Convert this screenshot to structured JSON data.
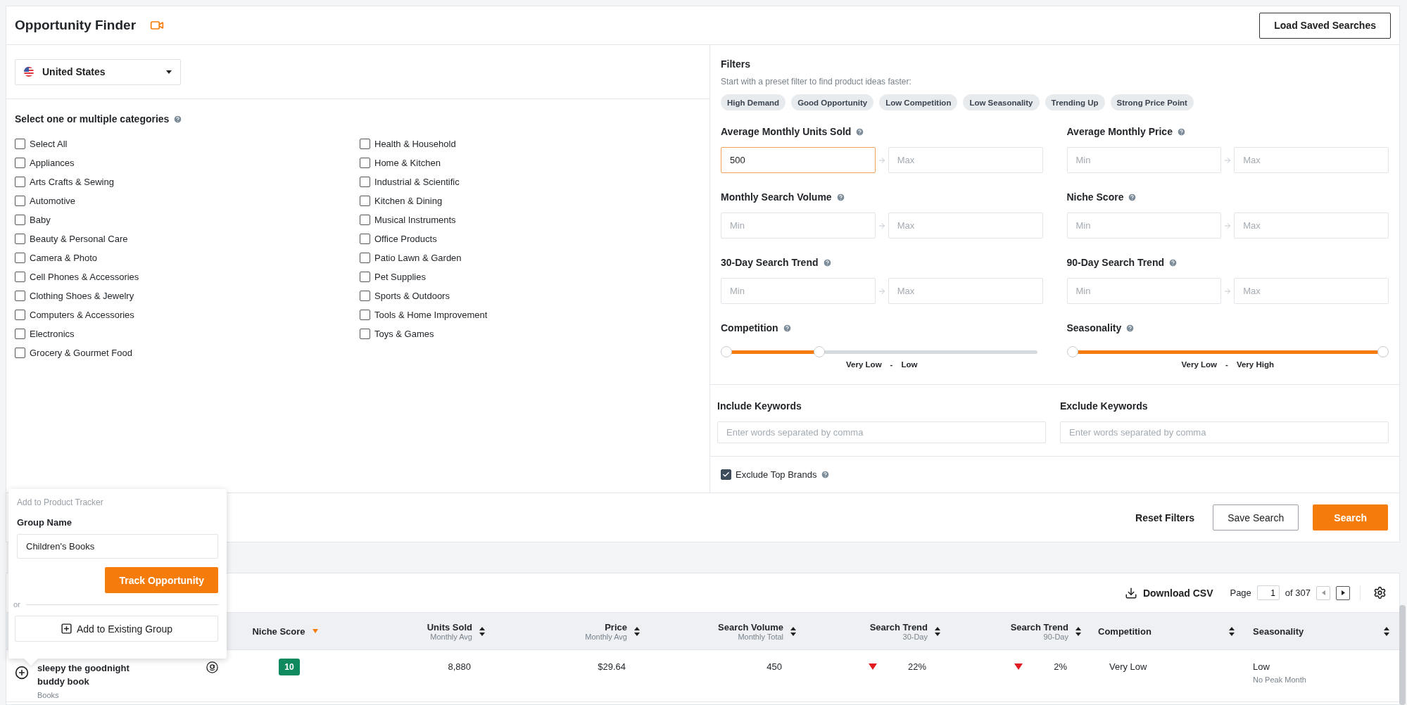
{
  "header": {
    "title": "Opportunity Finder",
    "load_button": "Load Saved Searches"
  },
  "country": {
    "value": "United States"
  },
  "categories": {
    "title": "Select one or multiple categories",
    "columns": [
      [
        {
          "label": "Select All",
          "checked": false
        },
        {
          "label": "Appliances",
          "checked": false
        },
        {
          "label": "Arts Crafts & Sewing",
          "checked": false
        },
        {
          "label": "Automotive",
          "checked": false
        },
        {
          "label": "Baby",
          "checked": false
        },
        {
          "label": "Beauty & Personal Care",
          "checked": false
        },
        {
          "label": "Camera & Photo",
          "checked": false
        },
        {
          "label": "Cell Phones & Accessories",
          "checked": false
        },
        {
          "label": "Clothing Shoes & Jewelry",
          "checked": false
        },
        {
          "label": "Computers & Accessories",
          "checked": false
        },
        {
          "label": "Electronics",
          "checked": false
        },
        {
          "label": "Grocery & Gourmet Food",
          "checked": false
        }
      ],
      [
        {
          "label": "Health & Household",
          "checked": false
        },
        {
          "label": "Home & Kitchen",
          "checked": false
        },
        {
          "label": "Industrial & Scientific",
          "checked": false
        },
        {
          "label": "Kitchen & Dining",
          "checked": false
        },
        {
          "label": "Musical Instruments",
          "checked": false
        },
        {
          "label": "Office Products",
          "checked": false
        },
        {
          "label": "Patio Lawn & Garden",
          "checked": false
        },
        {
          "label": "Pet Supplies",
          "checked": false
        },
        {
          "label": "Sports & Outdoors",
          "checked": false
        },
        {
          "label": "Tools & Home Improvement",
          "checked": false
        },
        {
          "label": "Toys & Games",
          "checked": false
        }
      ]
    ]
  },
  "filters": {
    "title": "Filters",
    "subtitle": "Start with a preset filter to find product ideas faster:",
    "presets": [
      "High Demand",
      "Good Opportunity",
      "Low Competition",
      "Low Seasonality",
      "Trending Up",
      "Strong Price Point"
    ],
    "ranges": [
      {
        "label": "Average Monthly Units Sold",
        "min": {
          "value": "500",
          "focused": true
        },
        "max": {
          "placeholder": "Max",
          "focused": false
        }
      },
      {
        "label": "Average Monthly Price",
        "min": {
          "placeholder": "Min",
          "focused": false
        },
        "max": {
          "placeholder": "Max",
          "focused": false
        }
      },
      {
        "label": "Monthly Search Volume",
        "min": {
          "placeholder": "Min",
          "focused": false
        },
        "max": {
          "placeholder": "Max",
          "focused": false
        }
      },
      {
        "label": "Niche Score",
        "min": {
          "placeholder": "Min",
          "focused": false
        },
        "max": {
          "placeholder": "Max",
          "focused": false
        }
      },
      {
        "label": "30-Day Search Trend",
        "min": {
          "placeholder": "Min",
          "focused": false
        },
        "max": {
          "placeholder": "Max",
          "focused": false
        }
      },
      {
        "label": "90-Day Search Trend",
        "min": {
          "placeholder": "Min",
          "focused": false
        },
        "max": {
          "placeholder": "Max",
          "focused": false
        }
      }
    ],
    "sliders": [
      {
        "label": "Competition",
        "thumbs": [
          {
            "level": 0
          },
          {
            "level": 0.3
          }
        ],
        "from": "Very Low",
        "separator": "-",
        "to": "Low"
      },
      {
        "label": "Seasonality",
        "thumbs": [
          {
            "level": 0
          },
          {
            "level": 1
          }
        ],
        "from": "Very Low",
        "separator": "-",
        "to": "Very High"
      }
    ],
    "keywords": [
      {
        "label": "Include Keywords",
        "placeholder": "Enter words separated by comma"
      },
      {
        "label": "Exclude Keywords",
        "placeholder": "Enter words separated by comma"
      }
    ],
    "exclude_top_brands": {
      "label": "Exclude Top Brands",
      "checked": true
    }
  },
  "actions": {
    "reset": "Reset Filters",
    "save": "Save Search",
    "search": "Search"
  },
  "results": {
    "download": "Download CSV",
    "page_label": "Page",
    "page": "1",
    "page_total": "of 307",
    "columns": [
      {
        "title": "Niche Score",
        "sorted": true
      },
      {
        "title": "Units Sold",
        "subtitle": "Monthly Avg",
        "sorted": false
      },
      {
        "title": "Price",
        "subtitle": "Monthly Avg",
        "sorted": false
      },
      {
        "title": "Search Volume",
        "subtitle": "Monthly Total",
        "sorted": false
      },
      {
        "title": "Search Trend",
        "subtitle": "30-Day",
        "sorted": false
      },
      {
        "title": "Search Trend",
        "subtitle": "90-Day",
        "sorted": false
      },
      {
        "title": "Competition",
        "sorted": false
      },
      {
        "title": "Seasonality",
        "sorted": false
      }
    ],
    "rows": [
      {
        "product": "sleepy the goodnight buddy book",
        "category": "Books",
        "niche_score": "10",
        "units_sold": "8,880",
        "price": "$29.64",
        "search_volume": "450",
        "trend_30": {
          "down": true,
          "value": "22%"
        },
        "trend_90": {
          "down": true,
          "value": "2%"
        },
        "competition": "Very Low",
        "seasonality": "Low",
        "seasonality_note": "No Peak Month"
      }
    ]
  },
  "popover": {
    "caption": "Add to Product Tracker",
    "group_label": "Group Name",
    "group_value": "Children's Books",
    "track_button": "Track Opportunity",
    "or": "or",
    "existing_button": "Add to Existing Group"
  }
}
